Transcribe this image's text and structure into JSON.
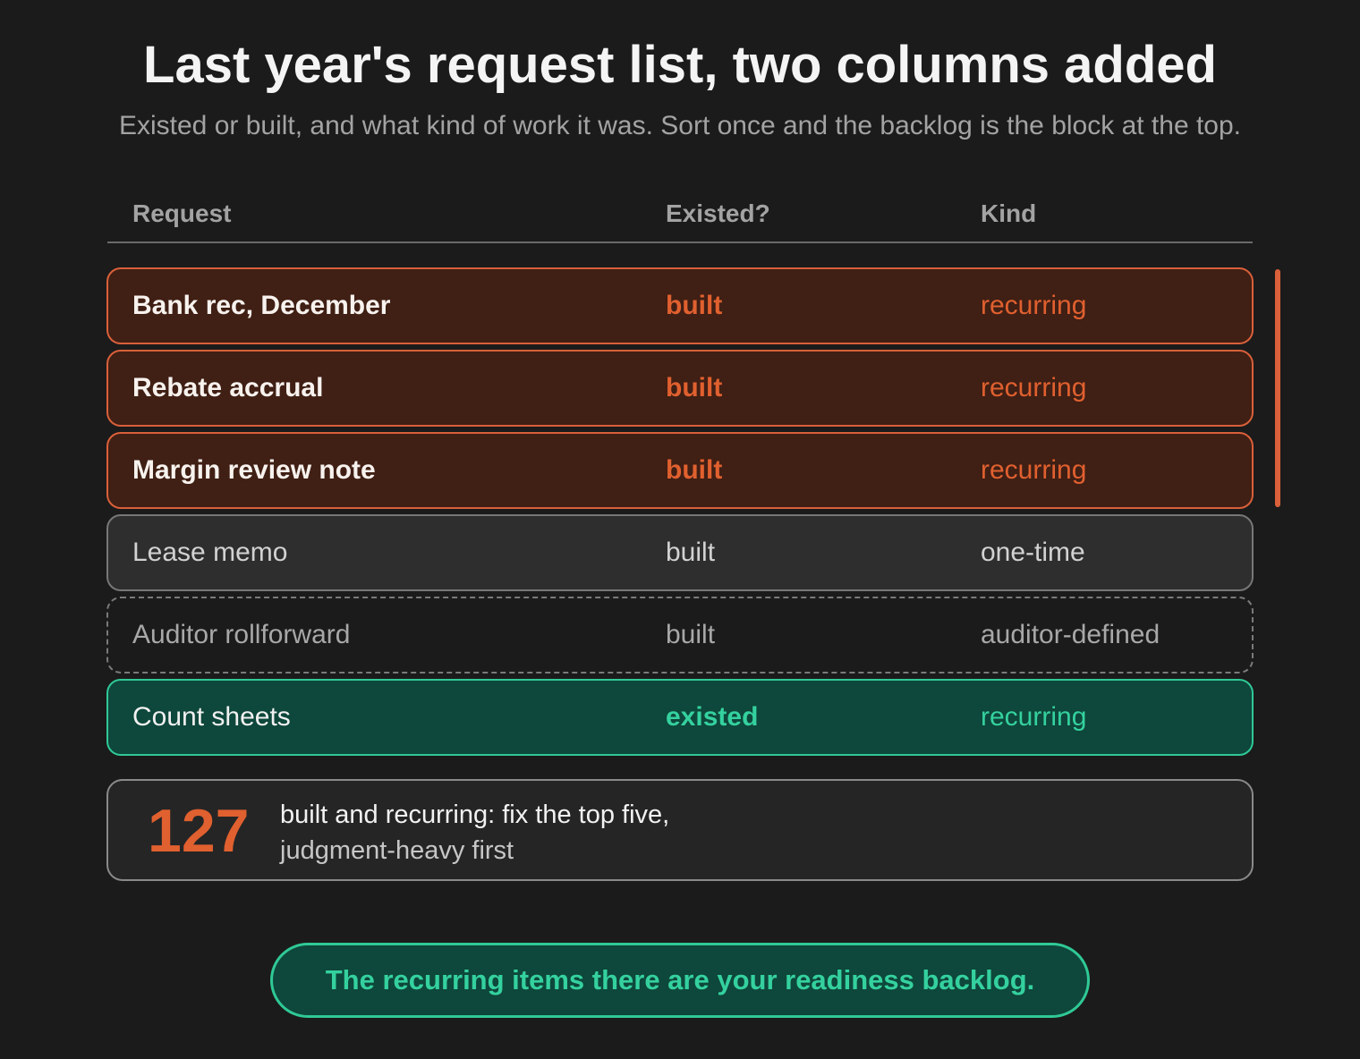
{
  "header": {
    "title": "Last year's request list, two columns added",
    "subtitle": "Existed or built, and what kind of work it was. Sort once and the backlog is the block at the top."
  },
  "table": {
    "columns": [
      "Request",
      "Existed?",
      "Kind"
    ],
    "rows": [
      {
        "request": "Bank rec, December",
        "existed": "built",
        "kind": "recurring",
        "style": "hot"
      },
      {
        "request": "Rebate accrual",
        "existed": "built",
        "kind": "recurring",
        "style": "hot"
      },
      {
        "request": "Margin review note",
        "existed": "built",
        "kind": "recurring",
        "style": "hot"
      },
      {
        "request": "Lease memo",
        "existed": "built",
        "kind": "one-time",
        "style": "plain"
      },
      {
        "request": "Auditor rollforward",
        "existed": "built",
        "kind": "auditor-defined",
        "style": "dashed"
      },
      {
        "request": "Count sheets",
        "existed": "existed",
        "kind": "recurring",
        "style": "good"
      }
    ]
  },
  "summary": {
    "count": "127",
    "line1": "built and recurring: fix the top five,",
    "line2": "judgment-heavy first"
  },
  "callout": {
    "text": "The recurring items there are your readiness backlog."
  },
  "colors": {
    "background": "#1b1b1b",
    "accent_orange": "#e0602f",
    "accent_green": "#34d19e"
  }
}
